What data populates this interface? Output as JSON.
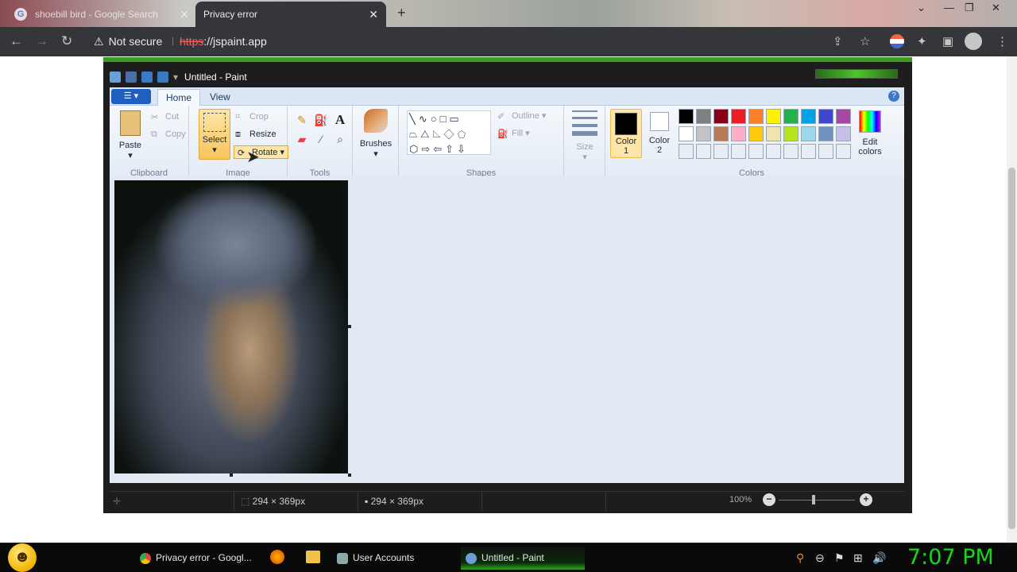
{
  "browser": {
    "tabs": [
      {
        "title": "shoebill bird - Google Search",
        "favicon": "G"
      },
      {
        "title": "Privacy error"
      }
    ],
    "address": {
      "security": "Not secure",
      "scheme": "https",
      "rest": "://jspaint.app"
    }
  },
  "paint": {
    "window_title": "Untitled - Paint",
    "ribbon_tabs": [
      "Home",
      "View"
    ],
    "clipboard": {
      "label": "Clipboard",
      "paste": "Paste",
      "cut": "Cut",
      "copy": "Copy"
    },
    "image": {
      "label": "Image",
      "select": "Select",
      "crop": "Crop",
      "resize": "Resize",
      "rotate": "Rotate"
    },
    "tools": {
      "label": "Tools"
    },
    "brushes": "Brushes",
    "shapes": {
      "label": "Shapes",
      "outline": "Outline",
      "fill": "Fill"
    },
    "size": "Size",
    "colors": {
      "label": "Colors",
      "color1": "Color",
      "color1_num": "1",
      "color2": "Color",
      "color2_num": "2",
      "edit": "Edit",
      "edit2": "colors",
      "palette_row1": [
        "#000000",
        "#7f7f7f",
        "#880015",
        "#ed1c24",
        "#ff7f27",
        "#fff200",
        "#22b14c",
        "#00a2e8",
        "#3f48cc",
        "#a349a4"
      ],
      "palette_row2": [
        "#ffffff",
        "#c3c3c3",
        "#b97a57",
        "#ffaec9",
        "#ffc90e",
        "#efe4b0",
        "#b5e61d",
        "#99d9ea",
        "#7092be",
        "#c8bfe7"
      ]
    },
    "status": {
      "selection_size": "294 × 369px",
      "canvas_size": "294 × 369px",
      "zoom": "100%"
    }
  },
  "taskbar": {
    "items": [
      "Privacy error - Googl...",
      "User Accounts",
      "Untitled - Paint"
    ],
    "clock": "7:07 PM"
  }
}
